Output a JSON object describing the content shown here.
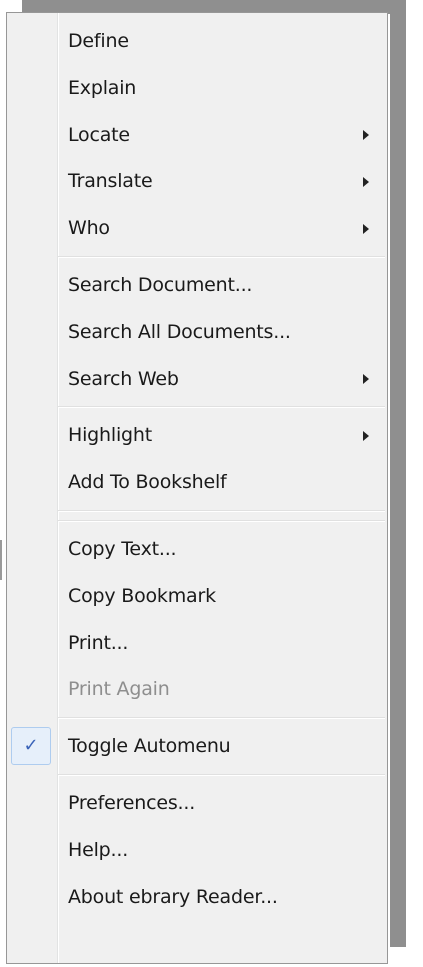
{
  "menu": {
    "groups": [
      {
        "items": [
          {
            "label": "Define",
            "submenu": false
          },
          {
            "label": "Explain",
            "submenu": false
          },
          {
            "label": "Locate",
            "submenu": true
          },
          {
            "label": "Translate",
            "submenu": true
          },
          {
            "label": "Who",
            "submenu": true
          }
        ]
      },
      {
        "items": [
          {
            "label": "Search Document...",
            "submenu": false
          },
          {
            "label": "Search All Documents...",
            "submenu": false
          },
          {
            "label": "Search Web",
            "submenu": true
          }
        ]
      },
      {
        "items": [
          {
            "label": "Highlight",
            "submenu": true
          },
          {
            "label": "Add To Bookshelf",
            "submenu": false
          }
        ]
      },
      {
        "items": []
      },
      {
        "items": [
          {
            "label": "Copy Text...",
            "submenu": false
          },
          {
            "label": "Copy Bookmark",
            "submenu": false
          },
          {
            "label": "Print...",
            "submenu": false
          },
          {
            "label": "Print Again",
            "submenu": false,
            "disabled": true
          }
        ]
      },
      {
        "items": [
          {
            "label": "Toggle Automenu",
            "submenu": false,
            "checked": true
          }
        ]
      },
      {
        "items": [
          {
            "label": "Preferences...",
            "submenu": false
          },
          {
            "label": "Help...",
            "submenu": false
          },
          {
            "label": "About ebrary Reader...",
            "submenu": false
          }
        ]
      }
    ],
    "check_glyph": "✓",
    "colors": {
      "background": "#f0f0f0",
      "border": "#979797",
      "text": "#1a1a1a",
      "disabled_text": "#8e8e8e",
      "check_highlight": "#e6effa",
      "check_border": "#aeccef",
      "shadow": "#8f8f8f"
    }
  }
}
